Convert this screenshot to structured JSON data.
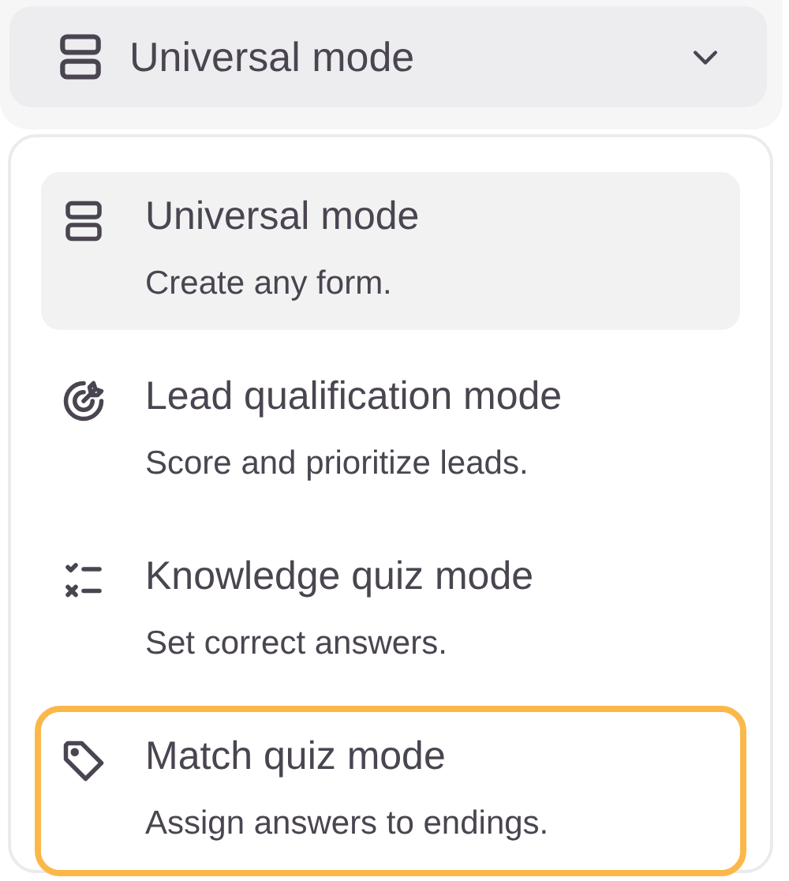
{
  "trigger": {
    "label": "Universal mode"
  },
  "options": [
    {
      "title": "Universal mode",
      "description": "Create any form.",
      "selected": true,
      "focused": false
    },
    {
      "title": "Lead qualification mode",
      "description": "Score and prioritize leads.",
      "selected": false,
      "focused": false
    },
    {
      "title": "Knowledge quiz mode",
      "description": "Set correct answers.",
      "selected": false,
      "focused": false
    },
    {
      "title": "Match quiz mode",
      "description": "Assign answers to endings.",
      "selected": false,
      "focused": true
    }
  ]
}
